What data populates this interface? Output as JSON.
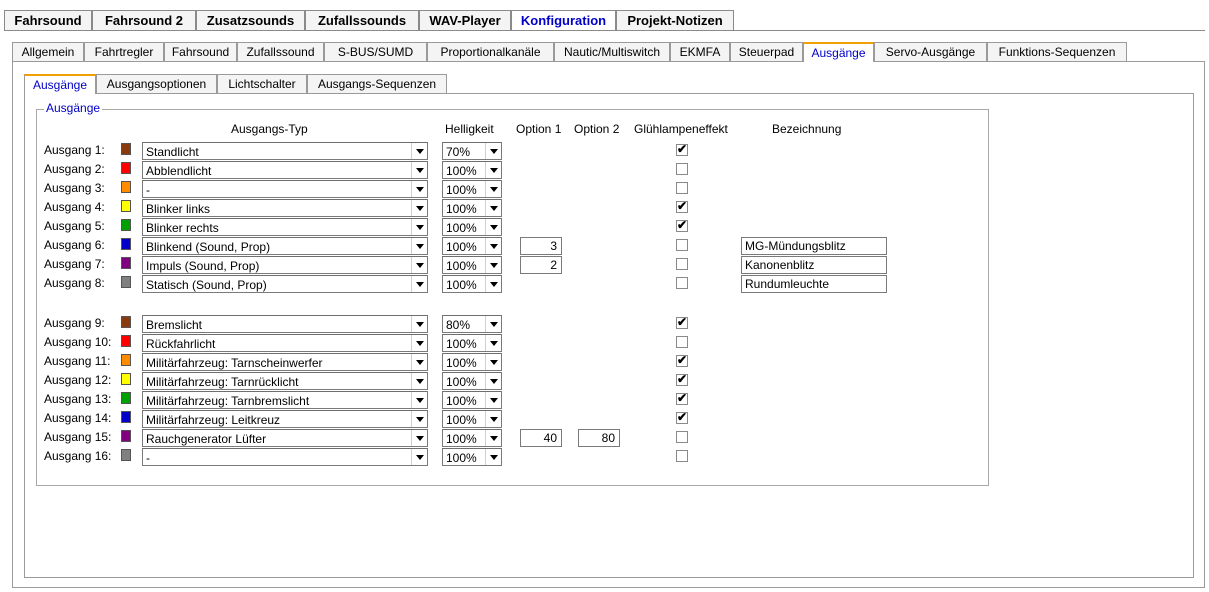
{
  "top_tabs": [
    {
      "label": "Fahrsound",
      "active": false
    },
    {
      "label": "Fahrsound 2",
      "active": false
    },
    {
      "label": "Zusatzsounds",
      "active": false
    },
    {
      "label": "Zufallssounds",
      "active": false
    },
    {
      "label": "WAV-Player",
      "active": false
    },
    {
      "label": "Konfiguration",
      "active": true
    },
    {
      "label": "Projekt-Notizen",
      "active": false
    }
  ],
  "config_tabs": [
    {
      "label": "Allgemein",
      "active": false
    },
    {
      "label": "Fahrtregler",
      "active": false
    },
    {
      "label": "Fahrsound",
      "active": false
    },
    {
      "label": "Zufallssound",
      "active": false
    },
    {
      "label": "S-BUS/SUMD",
      "active": false
    },
    {
      "label": "Proportionalkanäle",
      "active": false
    },
    {
      "label": "Nautic/Multiswitch",
      "active": false
    },
    {
      "label": "EKMFA",
      "active": false
    },
    {
      "label": "Steuerpad",
      "active": false
    },
    {
      "label": "Ausgänge",
      "active": true
    },
    {
      "label": "Servo-Ausgänge",
      "active": false
    },
    {
      "label": "Funktions-Sequenzen",
      "active": false
    }
  ],
  "output_tabs": [
    {
      "label": "Ausgänge",
      "active": true
    },
    {
      "label": "Ausgangsoptionen",
      "active": false
    },
    {
      "label": "Lichtschalter",
      "active": false
    },
    {
      "label": "Ausgangs-Sequenzen",
      "active": false
    }
  ],
  "group_title": "Ausgänge",
  "columns": {
    "type": "Ausgangs-Typ",
    "brightness": "Helligkeit",
    "option1": "Option 1",
    "option2": "Option 2",
    "bulb_effect": "Glühlampeneffekt",
    "name": "Bezeichnung"
  },
  "outputs": [
    {
      "label": "Ausgang 1:",
      "color": "#8b3a0f",
      "type": "Standlicht",
      "brightness": "70%",
      "option1": "",
      "option2": "",
      "bulb": true,
      "name": ""
    },
    {
      "label": "Ausgang 2:",
      "color": "#ff0000",
      "type": "Abblendlicht",
      "brightness": "100%",
      "option1": "",
      "option2": "",
      "bulb": false,
      "name": ""
    },
    {
      "label": "Ausgang 3:",
      "color": "#ff8c00",
      "type": "-",
      "brightness": "100%",
      "option1": "",
      "option2": "",
      "bulb": false,
      "name": ""
    },
    {
      "label": "Ausgang 4:",
      "color": "#ffff00",
      "type": "Blinker links",
      "brightness": "100%",
      "option1": "",
      "option2": "",
      "bulb": true,
      "name": ""
    },
    {
      "label": "Ausgang 5:",
      "color": "#00a000",
      "type": "Blinker rechts",
      "brightness": "100%",
      "option1": "",
      "option2": "",
      "bulb": true,
      "name": ""
    },
    {
      "label": "Ausgang 6:",
      "color": "#0000c8",
      "type": "Blinkend (Sound, Prop)",
      "brightness": "100%",
      "option1": "3",
      "option2": "",
      "bulb": false,
      "name": "MG-Mündungsblitz"
    },
    {
      "label": "Ausgang 7:",
      "color": "#800080",
      "type": "Impuls (Sound, Prop)",
      "brightness": "100%",
      "option1": "2",
      "option2": "",
      "bulb": false,
      "name": "Kanonenblitz"
    },
    {
      "label": "Ausgang 8:",
      "color": "#808080",
      "type": "Statisch (Sound, Prop)",
      "brightness": "100%",
      "option1": "",
      "option2": "",
      "bulb": false,
      "name": "Rundumleuchte"
    },
    {
      "label": "Ausgang 9:",
      "color": "#8b3a0f",
      "type": "Bremslicht",
      "brightness": "80%",
      "option1": "",
      "option2": "",
      "bulb": true,
      "name": ""
    },
    {
      "label": "Ausgang 10:",
      "color": "#ff0000",
      "type": "Rückfahrlicht",
      "brightness": "100%",
      "option1": "",
      "option2": "",
      "bulb": false,
      "name": ""
    },
    {
      "label": "Ausgang 11:",
      "color": "#ff8c00",
      "type": "Militärfahrzeug: Tarnscheinwerfer",
      "brightness": "100%",
      "option1": "",
      "option2": "",
      "bulb": true,
      "name": ""
    },
    {
      "label": "Ausgang 12:",
      "color": "#ffff00",
      "type": "Militärfahrzeug: Tarnrücklicht",
      "brightness": "100%",
      "option1": "",
      "option2": "",
      "bulb": true,
      "name": ""
    },
    {
      "label": "Ausgang 13:",
      "color": "#00a000",
      "type": "Militärfahrzeug: Tarnbremslicht",
      "brightness": "100%",
      "option1": "",
      "option2": "",
      "bulb": true,
      "name": ""
    },
    {
      "label": "Ausgang 14:",
      "color": "#0000c8",
      "type": "Militärfahrzeug: Leitkreuz",
      "brightness": "100%",
      "option1": "",
      "option2": "",
      "bulb": true,
      "name": ""
    },
    {
      "label": "Ausgang 15:",
      "color": "#800080",
      "type": "Rauchgenerator Lüfter",
      "brightness": "100%",
      "option1": "40",
      "option2": "80",
      "bulb": false,
      "name": ""
    },
    {
      "label": "Ausgang 16:",
      "color": "#808080",
      "type": "-",
      "brightness": "100%",
      "option1": "",
      "option2": "",
      "bulb": false,
      "name": ""
    }
  ]
}
